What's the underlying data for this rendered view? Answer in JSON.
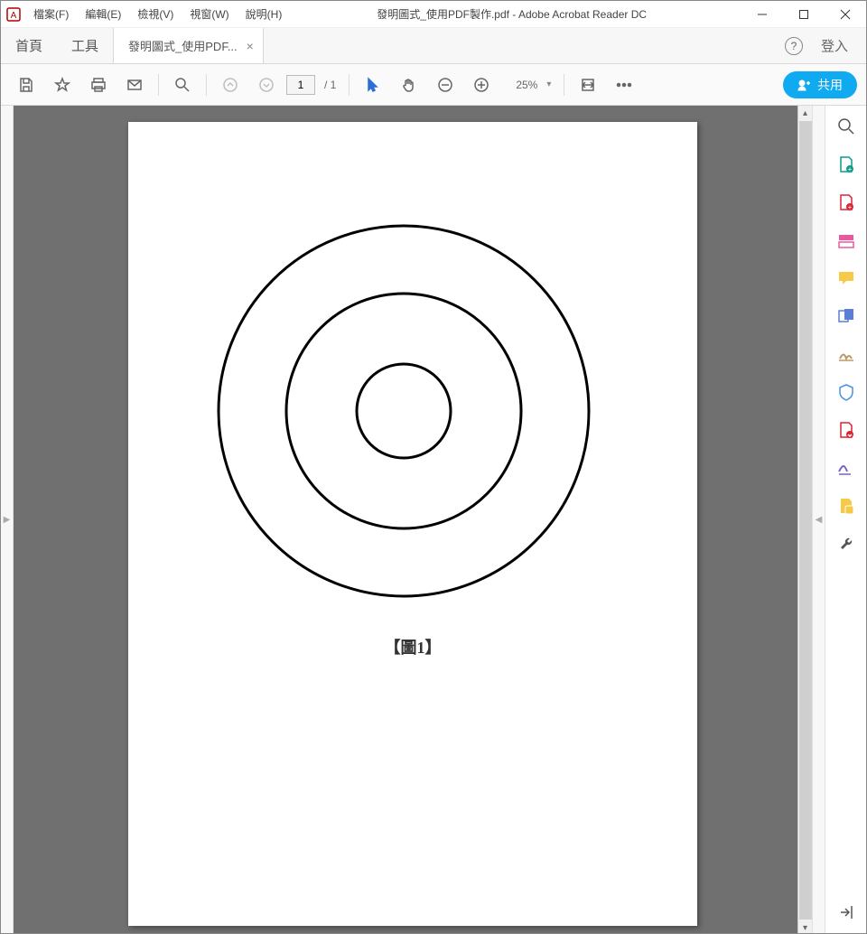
{
  "menubar": {
    "file": "檔案(F)",
    "edit": "編輯(E)",
    "view": "檢視(V)",
    "window": "視窗(W)",
    "help": "說明(H)"
  },
  "window": {
    "title": "發明圖式_使用PDF製作.pdf - Adobe Acrobat Reader DC"
  },
  "tabs": {
    "home": "首頁",
    "tools": "工具",
    "doc": "發明圖式_使用PDF...",
    "login": "登入"
  },
  "toolbar": {
    "page_current": "1",
    "page_total": "/ 1",
    "zoom": "25%",
    "share": "共用"
  },
  "document": {
    "figure_label": "【圖1】"
  }
}
